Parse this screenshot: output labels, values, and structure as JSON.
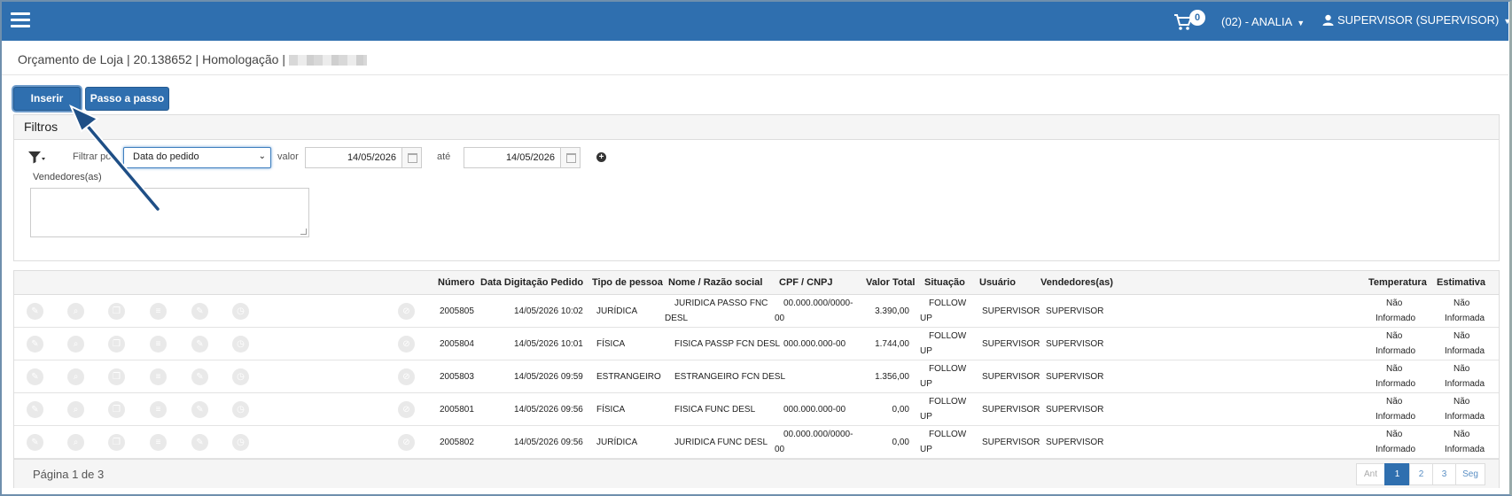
{
  "topbar": {
    "cart_count": "0",
    "store": "(02) - ANALIA",
    "user": "SUPERVISOR (SUPERVISOR)"
  },
  "breadcrumb": {
    "text": "Orçamento de Loja | 20.138652 | Homologação |"
  },
  "buttons": {
    "insert": "Inserir",
    "step": "Passo a passo"
  },
  "filters": {
    "title": "Filtros",
    "filter_by_label": "Filtrar por",
    "filter_by_value": "Data do pedido",
    "value_label": "valor",
    "date_from": "14/05/2026",
    "until_label": "até",
    "date_to": "14/05/2026",
    "sellers_label": "Vendedores(as)"
  },
  "table": {
    "headers": {
      "numero": "Número",
      "data": "Data Digitação Pedido",
      "tipo": "Tipo de pessoa",
      "nome": "Nome / Razão social",
      "cpf": "CPF / CNPJ",
      "valor": "Valor Total",
      "situacao": "Situação",
      "usuario": "Usuário",
      "vendedores": "Vendedores(as)",
      "temperatura": "Temperatura",
      "estimativa": "Estimativa"
    },
    "rows": [
      {
        "numero": "2005805",
        "data": "14/05/2026 10:02",
        "tipo": "JURÍDICA",
        "nome1": "JURIDICA PASSO FNC",
        "nome2": "DESL",
        "cpf1": "00.000.000/0000-",
        "cpf2": "00",
        "valor": "3.390,00",
        "sit1": "FOLLOW",
        "sit2": "UP",
        "usuario": "SUPERVISOR",
        "vendedor": "SUPERVISOR",
        "temp1": "Não",
        "temp2": "Informado",
        "est1": "Não",
        "est2": "Informada"
      },
      {
        "numero": "2005804",
        "data": "14/05/2026 10:01",
        "tipo": "FÍSICA",
        "nome1": "FISICA PASSP FCN DESL",
        "nome2": "",
        "cpf1": "000.000.000-00",
        "cpf2": "",
        "valor": "1.744,00",
        "sit1": "FOLLOW",
        "sit2": "UP",
        "usuario": "SUPERVISOR",
        "vendedor": "SUPERVISOR",
        "temp1": "Não",
        "temp2": "Informado",
        "est1": "Não",
        "est2": "Informada"
      },
      {
        "numero": "2005803",
        "data": "14/05/2026 09:59",
        "tipo": "ESTRANGEIRO",
        "nome1": "ESTRANGEIRO FCN DESL",
        "nome2": "",
        "cpf1": "",
        "cpf2": "",
        "valor": "1.356,00",
        "sit1": "FOLLOW",
        "sit2": "UP",
        "usuario": "SUPERVISOR",
        "vendedor": "SUPERVISOR",
        "temp1": "Não",
        "temp2": "Informado",
        "est1": "Não",
        "est2": "Informada"
      },
      {
        "numero": "2005801",
        "data": "14/05/2026 09:56",
        "tipo": "FÍSICA",
        "nome1": "FISICA FUNC DESL",
        "nome2": "",
        "cpf1": "000.000.000-00",
        "cpf2": "",
        "valor": "0,00",
        "sit1": "FOLLOW",
        "sit2": "UP",
        "usuario": "SUPERVISOR",
        "vendedor": "SUPERVISOR",
        "temp1": "Não",
        "temp2": "Informado",
        "est1": "Não",
        "est2": "Informada"
      },
      {
        "numero": "2005802",
        "data": "14/05/2026 09:56",
        "tipo": "JURÍDICA",
        "nome1": "JURIDICA FUNC DESL",
        "nome2": "",
        "cpf1": "00.000.000/0000-",
        "cpf2": "00",
        "valor": "0,00",
        "sit1": "FOLLOW",
        "sit2": "UP",
        "usuario": "SUPERVISOR",
        "vendedor": "SUPERVISOR",
        "temp1": "Não",
        "temp2": "Informado",
        "est1": "Não",
        "est2": "Informada"
      }
    ],
    "row_actions": [
      "edit-icon",
      "view-icon",
      "copy-icon",
      "list-icon",
      "edit-note-icon",
      "history-icon",
      "cancel-icon"
    ]
  },
  "footer": {
    "page_info": "Página 1 de 3",
    "pager": [
      "Ant",
      "1",
      "2",
      "3",
      "Seg"
    ],
    "current_page": "1"
  },
  "colors": {
    "primary": "#2f6faf",
    "annotation_arrow": "#1f4f86"
  }
}
